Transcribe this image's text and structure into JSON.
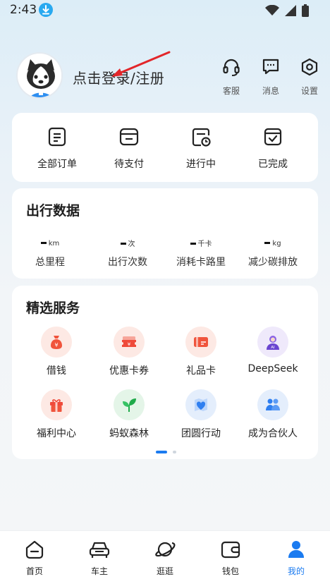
{
  "status_bar": {
    "time": "2:43"
  },
  "profile": {
    "login_text": "点击登录/注册"
  },
  "top_actions": [
    {
      "label": "客服",
      "icon": "headset-icon"
    },
    {
      "label": "消息",
      "icon": "message-icon"
    },
    {
      "label": "设置",
      "icon": "settings-icon"
    }
  ],
  "orders": [
    {
      "label": "全部订单",
      "icon": "all-orders-icon"
    },
    {
      "label": "待支付",
      "icon": "wallet-pay-icon"
    },
    {
      "label": "进行中",
      "icon": "in-progress-icon"
    },
    {
      "label": "已完成",
      "icon": "completed-icon"
    }
  ],
  "travel": {
    "title": "出行数据",
    "stats": [
      {
        "unit": "km",
        "label": "总里程"
      },
      {
        "unit": "次",
        "label": "出行次数"
      },
      {
        "unit": "千卡",
        "label": "消耗卡路里"
      },
      {
        "unit": "kg",
        "label": "减少碳排放"
      }
    ]
  },
  "services": {
    "title": "精选服务",
    "items": [
      {
        "label": "借钱",
        "icon": "money-bag-icon"
      },
      {
        "label": "优惠卡券",
        "icon": "coupon-icon"
      },
      {
        "label": "礼品卡",
        "icon": "gift-card-icon"
      },
      {
        "label": "DeepSeek",
        "icon": "ai-assistant-icon"
      },
      {
        "label": "福利中心",
        "icon": "gift-box-icon"
      },
      {
        "label": "蚂蚁森林",
        "icon": "sprout-icon"
      },
      {
        "label": "团圆行动",
        "icon": "heart-map-icon"
      },
      {
        "label": "成为合伙人",
        "icon": "partners-icon"
      }
    ]
  },
  "bottom_nav": [
    {
      "label": "首页",
      "icon": "home-icon",
      "active": false
    },
    {
      "label": "车主",
      "icon": "car-icon",
      "active": false
    },
    {
      "label": "逛逛",
      "icon": "planet-icon",
      "active": false
    },
    {
      "label": "钱包",
      "icon": "wallet-icon",
      "active": false
    },
    {
      "label": "我的",
      "icon": "profile-icon",
      "active": true
    }
  ],
  "colors": {
    "accent": "#1b7bf0",
    "download_badge": "#29a9f0",
    "annotation_arrow": "#e2262a"
  }
}
